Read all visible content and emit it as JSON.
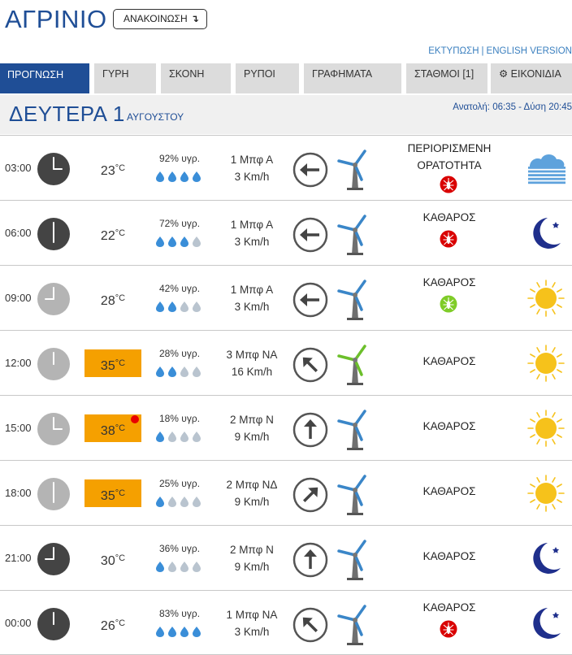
{
  "header": {
    "city": "ΑΓΡΙΝΙΟ",
    "announce_label": "ΑΝΑΚΟΙΝΩΣΗ",
    "announce_arrow": "↴",
    "print_link": "ΕΚΤΥΠΩΣΗ",
    "link_separator": "|",
    "english_link": "ENGLISH VERSION"
  },
  "tabs": [
    {
      "label": "ΠΡΟΓΝΩΣΗ",
      "active": true
    },
    {
      "label": "ΓΥΡΗ"
    },
    {
      "label": "ΣΚΟΝΗ"
    },
    {
      "label": "ΡΥΠΟΙ"
    },
    {
      "label": "ΓΡΑΦΗΜΑΤΑ"
    },
    {
      "label": "ΣΤΑΘΜΟΙ  [1]"
    },
    {
      "label": "⚙ ΕΙΚΟΝΙΔΙΑ"
    }
  ],
  "day": {
    "name": "ΔΕΥΤΕΡΑ 1",
    "month": "ΑΥΓΟΥΣΤΟΥ",
    "sun_times": "Ανατολή: 06:35 - Δύση 20:45"
  },
  "colors": {
    "accent": "#1f4e96",
    "hot_temp": "#f5a000",
    "drop_full": "#3a8ed8",
    "drop_empty": "#b9c4cf",
    "night_clock": "#444444",
    "day_clock": "#b4b4b4",
    "moon": "#1f2f8c",
    "sun": "#f6c21b",
    "mosquito_red": "#d90000",
    "mosquito_green": "#7fcc28",
    "turbine_blue": "#3a86c8",
    "turbine_green": "#6cbf2b"
  },
  "rows": [
    {
      "time": "03:00",
      "clock_hour": 3,
      "night": true,
      "temp": "23",
      "unit": "°C",
      "hot": false,
      "hot_marker": false,
      "hum": "92% υγρ.",
      "drops": 4,
      "wind_bft": "1 Μπφ Α",
      "wind_kmh": "3 Km/h",
      "wind_dir_deg": 270,
      "turbine": "blue",
      "cond_lines": [
        "ΠΕΡΙΟΡΙΣΜΕΝΗ",
        "ΟΡΑΤΟΤΗΤΑ"
      ],
      "mosquito": "red",
      "weather_icon": "fog-cloud-icon"
    },
    {
      "time": "06:00",
      "clock_hour": 6,
      "night": true,
      "temp": "22",
      "unit": "°C",
      "hot": false,
      "hot_marker": false,
      "hum": "72% υγρ.",
      "drops": 3,
      "wind_bft": "1 Μπφ Α",
      "wind_kmh": "3 Km/h",
      "wind_dir_deg": 270,
      "turbine": "blue",
      "cond_lines": [
        "ΚΑΘΑΡΟΣ"
      ],
      "mosquito": "red",
      "weather_icon": "moon-icon"
    },
    {
      "time": "09:00",
      "clock_hour": 9,
      "night": false,
      "temp": "28",
      "unit": "°C",
      "hot": false,
      "hot_marker": false,
      "hum": "42% υγρ.",
      "drops": 2,
      "wind_bft": "1 Μπφ Α",
      "wind_kmh": "3 Km/h",
      "wind_dir_deg": 270,
      "turbine": "blue",
      "cond_lines": [
        "ΚΑΘΑΡΟΣ"
      ],
      "mosquito": "green",
      "weather_icon": "sun-icon"
    },
    {
      "time": "12:00",
      "clock_hour": 12,
      "night": false,
      "temp": "35",
      "unit": "°C",
      "hot": true,
      "hot_marker": false,
      "hum": "28% υγρ.",
      "drops": 2,
      "wind_bft": "3 Μπφ ΝΑ",
      "wind_kmh": "16 Km/h",
      "wind_dir_deg": 315,
      "turbine": "green",
      "cond_lines": [
        "ΚΑΘΑΡΟΣ"
      ],
      "mosquito": "",
      "weather_icon": "sun-icon"
    },
    {
      "time": "15:00",
      "clock_hour": 3,
      "night": false,
      "temp": "38",
      "unit": "°C",
      "hot": true,
      "hot_marker": true,
      "hum": "18% υγρ.",
      "drops": 1,
      "wind_bft": "2 Μπφ Ν",
      "wind_kmh": "9 Km/h",
      "wind_dir_deg": 0,
      "turbine": "blue",
      "cond_lines": [
        "ΚΑΘΑΡΟΣ"
      ],
      "mosquito": "",
      "weather_icon": "sun-icon"
    },
    {
      "time": "18:00",
      "clock_hour": 6,
      "night": false,
      "temp": "35",
      "unit": "°C",
      "hot": true,
      "hot_marker": false,
      "hum": "25% υγρ.",
      "drops": 1,
      "wind_bft": "2 Μπφ ΝΔ",
      "wind_kmh": "9 Km/h",
      "wind_dir_deg": 45,
      "turbine": "blue",
      "cond_lines": [
        "ΚΑΘΑΡΟΣ"
      ],
      "mosquito": "",
      "weather_icon": "sun-icon"
    },
    {
      "time": "21:00",
      "clock_hour": 9,
      "night": true,
      "temp": "30",
      "unit": "°C",
      "hot": false,
      "hot_marker": false,
      "hum": "36% υγρ.",
      "drops": 1,
      "wind_bft": "2 Μπφ Ν",
      "wind_kmh": "9 Km/h",
      "wind_dir_deg": 0,
      "turbine": "blue",
      "cond_lines": [
        "ΚΑΘΑΡΟΣ"
      ],
      "mosquito": "",
      "weather_icon": "moon-icon"
    },
    {
      "time": "00:00",
      "clock_hour": 12,
      "night": true,
      "temp": "26",
      "unit": "°C",
      "hot": false,
      "hot_marker": false,
      "hum": "83% υγρ.",
      "drops": 4,
      "wind_bft": "1 Μπφ ΝΑ",
      "wind_kmh": "3 Km/h",
      "wind_dir_deg": 315,
      "turbine": "blue",
      "cond_lines": [
        "ΚΑΘΑΡΟΣ"
      ],
      "mosquito": "red",
      "weather_icon": "moon-icon"
    }
  ]
}
